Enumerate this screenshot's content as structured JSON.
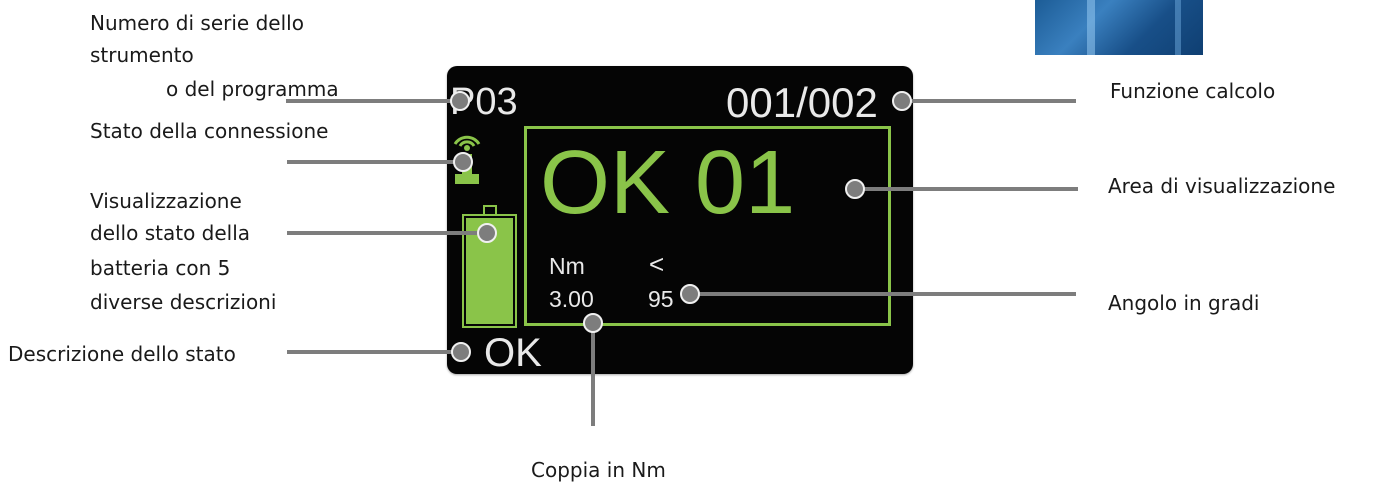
{
  "labels": {
    "serial_line1": "Numero di serie dello",
    "serial_line2": "strumento",
    "serial_line3": "o del programma",
    "connection": "Stato della connessione",
    "battery_line1": "Visualizzazione",
    "battery_line2": "dello stato della",
    "battery_line3": "batteria con 5",
    "battery_line4": "diverse descrizioni",
    "status_desc": "Descrizione dello stato",
    "calc_function": "Funzione calcolo",
    "display_area": "Area di visualizzazione",
    "angle": "Angolo in gradi",
    "torque": "Coppia in Nm"
  },
  "screen": {
    "program": "P03",
    "counter": "001/002",
    "big_status": "OK 01",
    "unit": "Nm",
    "angle_symbol": "<",
    "torque_value": "3.00",
    "angle_value": "95",
    "status": "OK"
  },
  "colors": {
    "accent_green": "#8ac449",
    "screen_bg": "#050505",
    "screen_text": "#e9e9e9",
    "leader_line": "#7d7d7d"
  },
  "icons": {
    "connection": "antenna-signal-icon",
    "battery": "battery-full-icon"
  }
}
